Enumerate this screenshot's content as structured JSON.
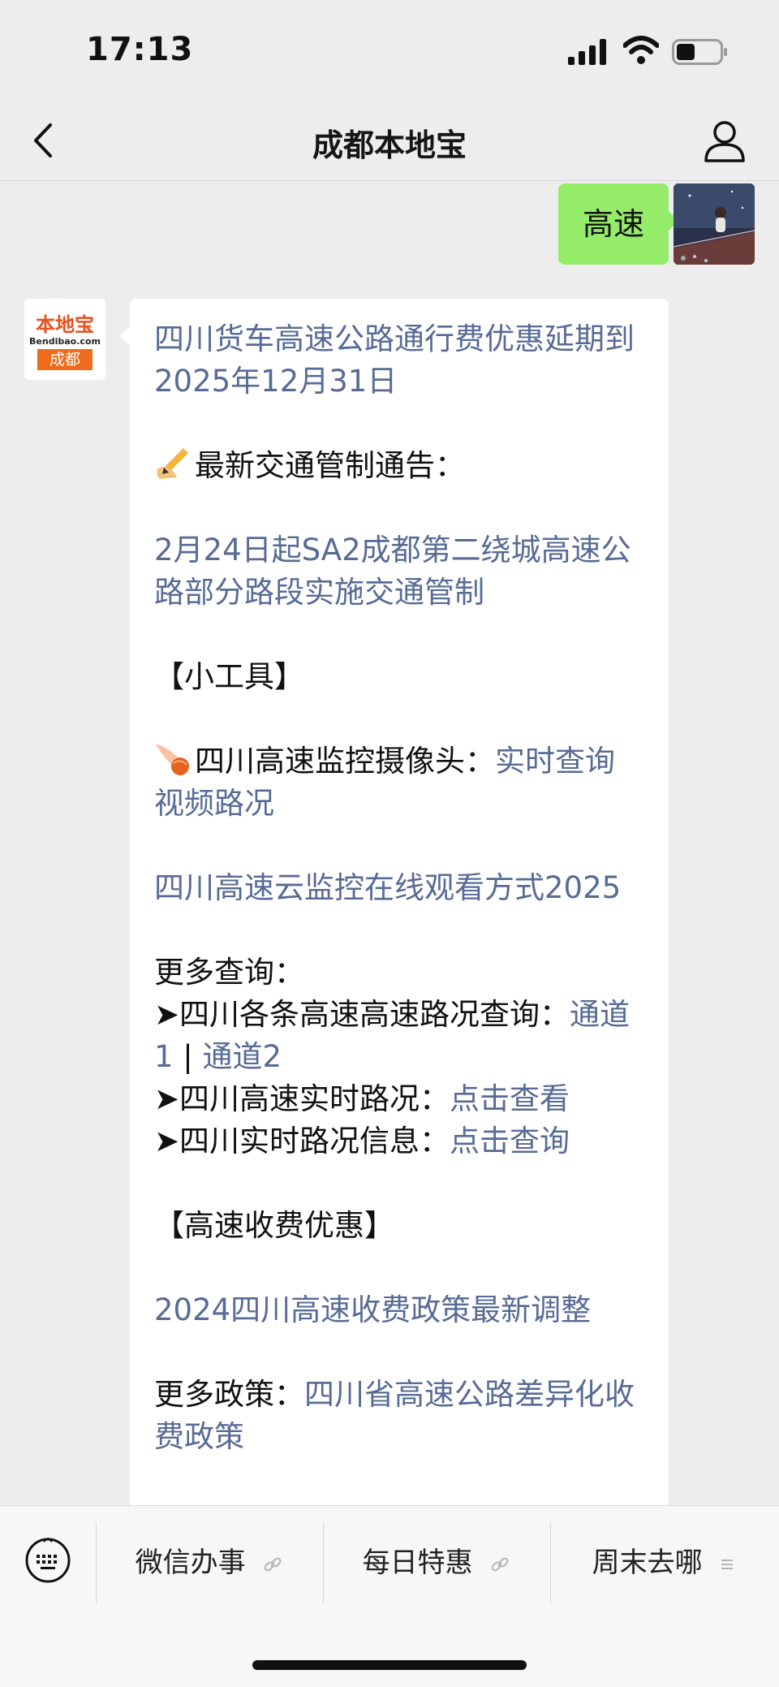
{
  "status_bar": {
    "time": "17:13",
    "signal_icon": "cellular-signal-icon",
    "wifi_icon": "wifi-icon",
    "battery_icon": "battery-icon"
  },
  "nav": {
    "title": "成都本地宝",
    "back_icon": "chevron-left-icon",
    "profile_icon": "person-icon"
  },
  "user_message": {
    "text": "高速"
  },
  "bot_avatar": {
    "logo_text": "本地宝",
    "logo_domain": "Bendibao.com",
    "logo_city": "成都"
  },
  "bot_message": {
    "headline_link": "四川货车高速公路通行费优惠延期到2025年12月31日",
    "traffic_notice_label": "最新交通管制通告：",
    "traffic_notice_link": "2月24日起SA2成都第二绕城高速公路部分路段实施交通管制",
    "tools_heading": "【小工具】",
    "camera_label": "四川高速监控摄像头：",
    "camera_link": "实时查询视频路况",
    "cloud_link": "四川高速云监控在线观看方式2025",
    "more_query_label": "更多查询：",
    "road_query_label": "➤四川各条高速高速路况查询：",
    "channel1": "通道1",
    "separator": " | ",
    "channel2": "通道2",
    "realtime_label": "➤四川高速实时路况：",
    "realtime_link": "点击查看",
    "info_label": "➤四川实时路况信息：",
    "info_link": "点击查询",
    "toll_heading": "【高速收费优惠】",
    "toll_policy_link": "2024四川高速收费政策最新调整",
    "more_policy_label": "更多政策：",
    "more_policy_link": "四川省高速公路差异化收费政策"
  },
  "bottom_menu": {
    "keyboard_icon": "keyboard-icon",
    "items": [
      {
        "label": "微信办事",
        "icon": "link-icon"
      },
      {
        "label": "每日特惠",
        "icon": "link-icon"
      },
      {
        "label": "周末去哪",
        "icon": "submenu-icon"
      }
    ]
  },
  "colors": {
    "link": "#576b95",
    "user_bubble": "#95ec69",
    "background": "#ededed",
    "brand_orange": "#ef6b1c"
  }
}
